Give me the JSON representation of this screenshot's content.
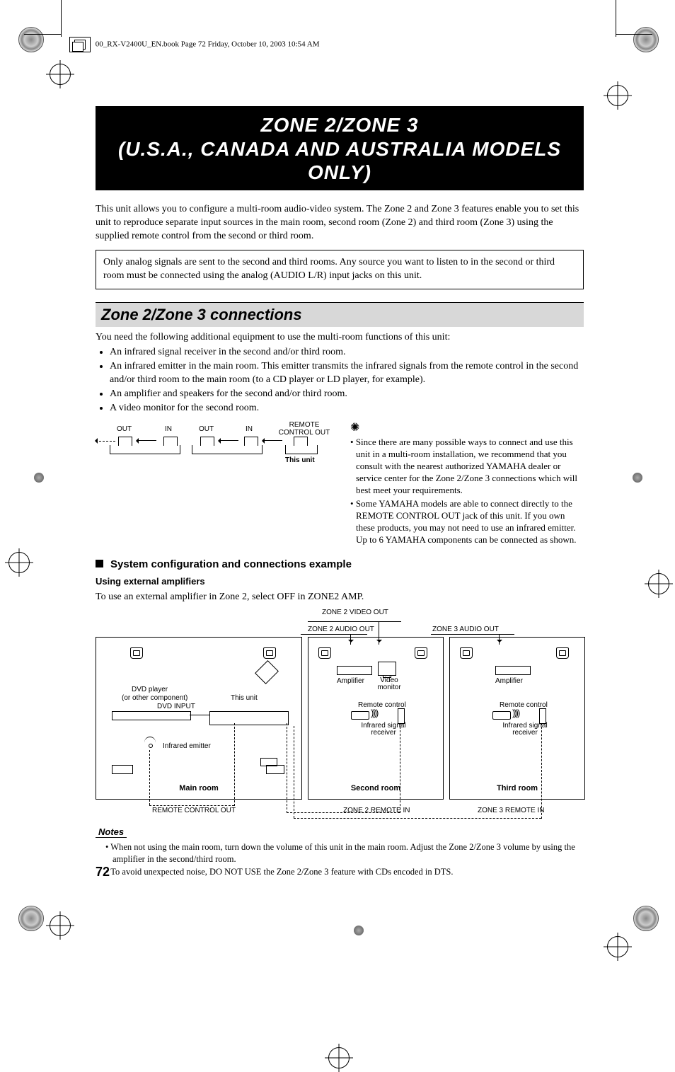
{
  "folio": "00_RX-V2400U_EN.book  Page 72  Friday, October 10, 2003  10:54 AM",
  "title": {
    "line1": "ZONE 2/ZONE 3",
    "line2": "(U.S.A., CANADA AND AUSTRALIA MODELS ONLY)"
  },
  "intro": "This unit allows you to configure a multi-room audio-video system. The Zone 2 and Zone 3 features enable you to set this unit to reproduce separate input sources in the main room, second room (Zone 2) and third room (Zone 3) using the supplied remote control from the second or third room.",
  "analog_note": "Only analog signals are sent to the second and third rooms. Any source you want to listen to in the second or third room must be connected using the analog (AUDIO L/R) input jacks on this unit.",
  "section_header": "Zone 2/Zone 3 connections",
  "equip_intro": "You need the following additional equipment to use the multi-room functions of this unit:",
  "equip_list": [
    "An infrared signal receiver in the second and/or third room.",
    "An infrared emitter in the main room. This emitter transmits the infrared signals from the remote control in the second and/or third room to the main room (to a CD player or LD player, for example).",
    "An amplifier and speakers for the second and/or third room.",
    "A video monitor for the second room."
  ],
  "diag1": {
    "out1": "OUT",
    "in1": "IN",
    "out2": "OUT",
    "in2": "IN",
    "rco": "REMOTE CONTROL OUT",
    "this_unit": "This unit"
  },
  "tips": [
    "Since there are many possible ways to connect and use this unit in a multi-room installation, we recommend that you consult with the nearest authorized YAMAHA dealer or service center for the Zone 2/Zone 3 connections which will best meet your requirements.",
    "Some YAMAHA models are able to connect directly to the REMOTE CONTROL OUT jack of this unit. If you own these products, you may not need to use an infrared emitter. Up to 6 YAMAHA components can be connected as shown."
  ],
  "sub_head": "System configuration and connections example",
  "sub_sub": "Using external amplifiers",
  "ext_amp_text": "To use an external amplifier in Zone 2, select OFF in ZONE2 AMP.",
  "diag2": {
    "z2video": "ZONE 2 VIDEO OUT",
    "z2audio": "ZONE 2 AUDIO OUT",
    "z3audio": "ZONE 3 AUDIO OUT",
    "dvd": "DVD player",
    "dvd_sub": "(or other component)",
    "dvd_input": "DVD INPUT",
    "this_unit": "This unit",
    "emitter": "Infrared emitter",
    "main_room": "Main room",
    "amp": "Amplifier",
    "video_mon": "Video monitor",
    "remote": "Remote control",
    "ir_recv": "Infrared signal receiver",
    "second_room": "Second room",
    "third_room": "Third room",
    "rco": "REMOTE CONTROL OUT",
    "z2ri": "ZONE 2 REMOTE IN",
    "z3ri": "ZONE 3 REMOTE IN"
  },
  "notes_label": "Notes",
  "notes": [
    "When not using the main room, turn down the volume of this unit in the main room. Adjust the Zone 2/Zone 3 volume by using the amplifier in the second/third room.",
    "To avoid unexpected noise, DO NOT USE the Zone 2/Zone 3 feature with CDs encoded in DTS."
  ],
  "page_num": "72"
}
